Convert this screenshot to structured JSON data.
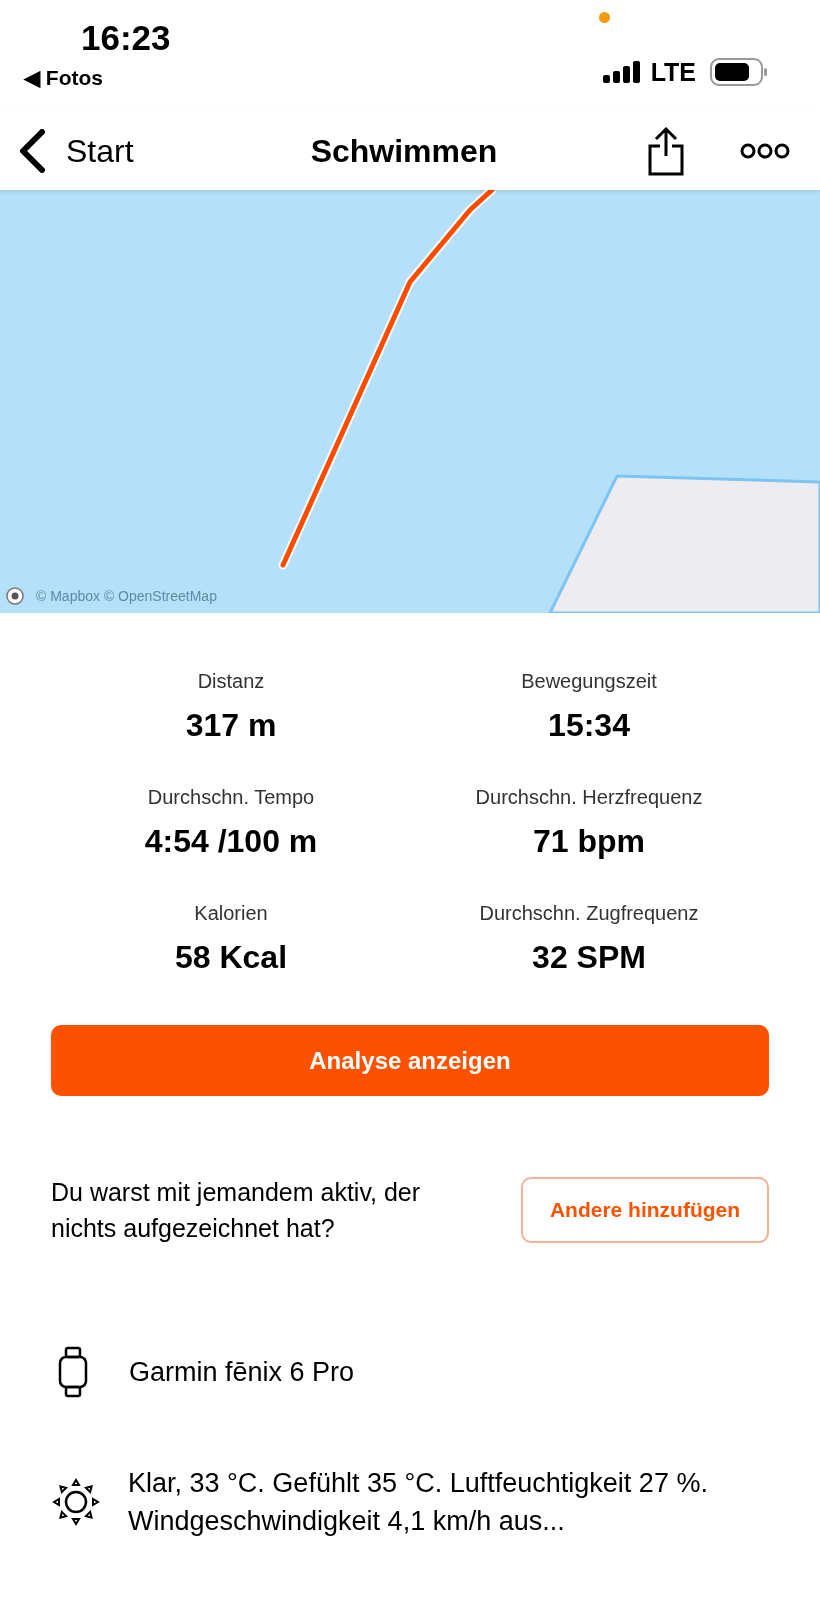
{
  "status_bar": {
    "time": "16:23",
    "back_app": "◀ Fotos",
    "network": "LTE"
  },
  "nav": {
    "back": "Start",
    "title": "Schwimmen"
  },
  "map": {
    "kind": "picture",
    "attribution": "© Mapbox © OpenStreetMap"
  },
  "stats": [
    {
      "label": "Distanz",
      "value": "317 m"
    },
    {
      "label": "Bewegungszeit",
      "value": "15:34"
    },
    {
      "label": "Durchschn. Tempo",
      "value": "4:54 /100 m"
    },
    {
      "label": "Durchschn. Herzfrequenz",
      "value": "71 bpm"
    },
    {
      "label": "Kalorien",
      "value": "58 Kcal"
    },
    {
      "label": "Durchschn. Zugfrequenz",
      "value": "32 SPM"
    }
  ],
  "analysis_button": "Analyse anzeigen",
  "partner": {
    "question": "Du warst mit jemandem aktiv, der nichts aufgezeichnet hat?",
    "button": "Andere hinzufügen"
  },
  "device": "Garmin fēnix 6 Pro",
  "weather": "Klar, 33 °C. Gefühlt 35 °C. Luftfeuchtigkeit 27 %. Windgeschwindigkeit 4,1 km/h aus..."
}
